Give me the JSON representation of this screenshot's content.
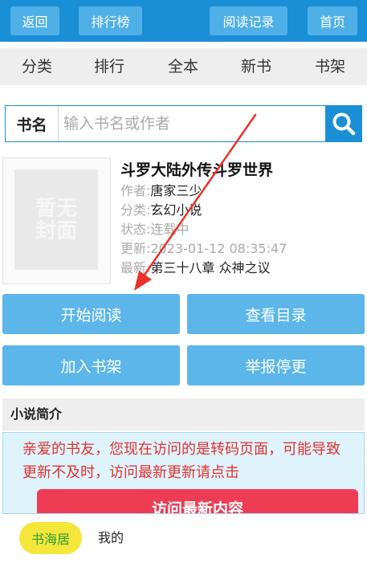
{
  "topbar": {
    "back": "返回",
    "ranking": "排行榜",
    "history": "阅读记录",
    "home": "首页"
  },
  "nav": [
    "分类",
    "排行",
    "全本",
    "新书",
    "书架"
  ],
  "search": {
    "label": "书名",
    "placeholder": "输入书名或作者",
    "icon": "search-icon"
  },
  "book": {
    "cover_text": "暂无封面",
    "title": "斗罗大陆外传斗罗世界",
    "author_label": "作者:",
    "author": "唐家三少",
    "category_label": "分类:",
    "category": "玄幻小说",
    "status_label": "状态:",
    "status": "连载中",
    "update_label": "更新:",
    "update_time": "2023-01-12 08:35:47",
    "latest_label": "最新:",
    "latest": "第三十八章 众神之议"
  },
  "actions": {
    "start_reading": "开始阅读",
    "catalog": "查看目录",
    "add_shelf": "加入书架",
    "report": "举报停更"
  },
  "intro": {
    "heading": "小说简介",
    "notice": "亲爱的书友，您现在访问的是转码页面，可能导致更新不及时，访问最新更新请点击",
    "notice_button": "访问最新内容"
  },
  "bottom": {
    "tab_active": "书海居",
    "tab_mine": "我的"
  },
  "colors": {
    "primary": "#1a8fd6",
    "button": "#5cb6e9",
    "notice_text": "#e03232",
    "notice_button": "#ee3c55",
    "annotation_arrow": "#e8322a"
  }
}
